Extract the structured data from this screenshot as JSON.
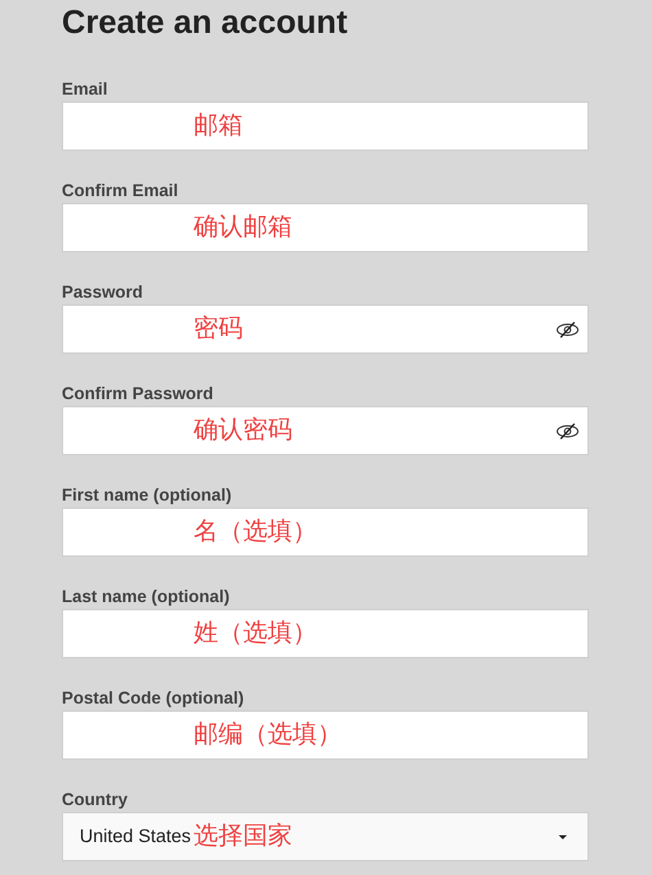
{
  "title": "Create an account",
  "fields": [
    {
      "label": "Email",
      "kind": "text",
      "annotation": "邮箱"
    },
    {
      "label": "Confirm Email",
      "kind": "text",
      "annotation": "确认邮箱"
    },
    {
      "label": "Password",
      "kind": "password",
      "annotation": "密码"
    },
    {
      "label": "Confirm Password",
      "kind": "password",
      "annotation": "确认密码"
    },
    {
      "label": "First name (optional)",
      "kind": "text",
      "annotation": "名（选填）"
    },
    {
      "label": "Last name (optional)",
      "kind": "text",
      "annotation": "姓（选填）"
    },
    {
      "label": "Postal Code (optional)",
      "kind": "text",
      "annotation": "邮编（选填）"
    },
    {
      "label": "Country",
      "kind": "select",
      "value": "United States",
      "annotation": "选择国家"
    }
  ]
}
